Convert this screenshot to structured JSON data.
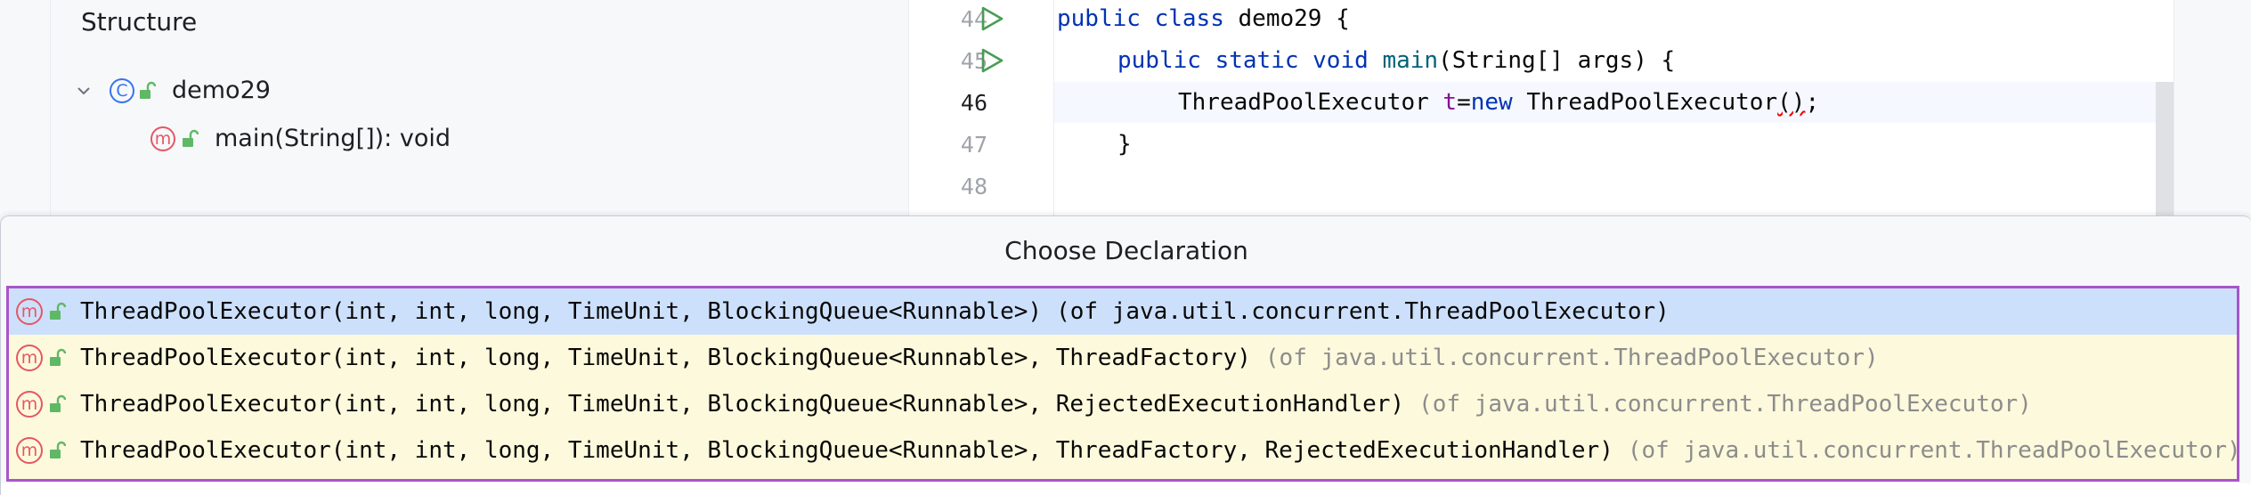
{
  "structure": {
    "title": "Structure",
    "class_node": {
      "label": "demo29",
      "kind": "C"
    },
    "method_node": {
      "label": "main(String[]): void",
      "kind": "m"
    }
  },
  "editor": {
    "lines": [
      {
        "number": "44",
        "has_run": true
      },
      {
        "number": "45",
        "has_run": true
      },
      {
        "number": "46",
        "has_run": false
      },
      {
        "number": "47",
        "has_run": false
      },
      {
        "number": "48",
        "has_run": false
      }
    ],
    "code": {
      "l44_kw1": "public",
      "l44_kw2": "class",
      "l44_name": "demo29 {",
      "l45_kw1": "public",
      "l45_kw2": "static",
      "l45_kw3": "void",
      "l45_fn": "main",
      "l45_rest": "(String[] args) {",
      "l46_type": "ThreadPoolExecutor ",
      "l46_var": "t",
      "l46_eq": "=",
      "l46_new": "new",
      "l46_ctor": " ThreadPoolExecutor",
      "l46_paren": "()",
      "l46_end": ";",
      "l47": "}"
    }
  },
  "popup": {
    "title": "Choose Declaration",
    "items": [
      {
        "signature": "ThreadPoolExecutor(int, int, long, TimeUnit, BlockingQueue<Runnable>)",
        "owner": "(of java.util.concurrent.ThreadPoolExecutor)"
      },
      {
        "signature": "ThreadPoolExecutor(int, int, long, TimeUnit, BlockingQueue<Runnable>, ThreadFactory)",
        "owner": "(of java.util.concurrent.ThreadPoolExecutor)"
      },
      {
        "signature": "ThreadPoolExecutor(int, int, long, TimeUnit, BlockingQueue<Runnable>, RejectedExecutionHandler)",
        "owner": "(of java.util.concurrent.ThreadPoolExecutor)"
      },
      {
        "signature": "ThreadPoolExecutor(int, int, long, TimeUnit, BlockingQueue<Runnable>, ThreadFactory, RejectedExecutionHandler)",
        "owner": "(of java.util.concurrent.ThreadPoolExecutor)"
      }
    ],
    "method_badge": "m"
  },
  "colors": {
    "selection": "#cde0fb",
    "list_background": "#fdf9dc",
    "highlight_border": "#a855c9",
    "method_icon": "#e55765",
    "class_icon": "#3574f0",
    "run_icon": "#499c54"
  }
}
